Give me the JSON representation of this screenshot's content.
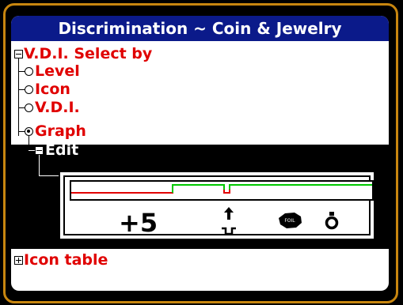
{
  "window": {
    "title": "Discrimination ~ Coin & Jewelry"
  },
  "tree": {
    "root_label": "V.D.I. Select by",
    "options": [
      {
        "label": "Level",
        "selected": false
      },
      {
        "label": "Icon",
        "selected": false
      },
      {
        "label": "V.D.I.",
        "selected": false
      },
      {
        "label": "Graph",
        "selected": true
      }
    ],
    "edit_label": "Edit",
    "icon_table_label": "Icon table"
  },
  "editor": {
    "vdi_value": "+5",
    "cursor_icon": "up-arrow-icon",
    "notch_icon": "notch-symbol-icon",
    "target_icon": "foil-target-icon",
    "ring_icon": "ring-icon",
    "foil_label": "FOIL"
  },
  "colors": {
    "title_bg": "#0b1a8a",
    "accent_text": "#e00000",
    "reject_line": "#e00000",
    "accept_line": "#00c800",
    "frame": "#c8860f"
  }
}
